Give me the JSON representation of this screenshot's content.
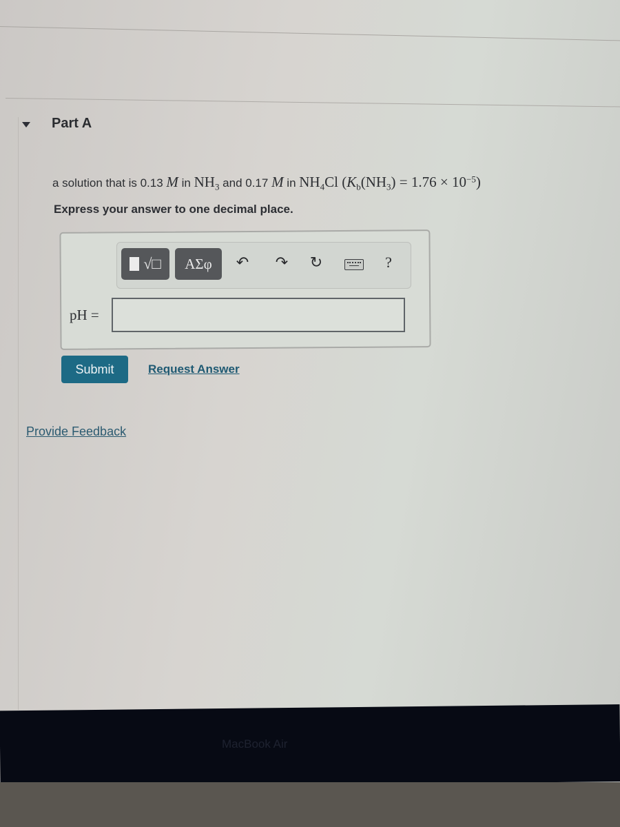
{
  "part": {
    "title": "Part A",
    "expanded": true
  },
  "question": {
    "prefix": "a solution that is ",
    "conc1": "0.13",
    "unit": "M",
    "in1": " in ",
    "species1": "NH",
    "species1_sub": "3",
    "and": " and ",
    "conc2": "0.17",
    "in2": " in ",
    "species2a": "NH",
    "species2_sub": "4",
    "species2b": "Cl",
    "kb_open": " (",
    "kb_symbol": "K",
    "kb_sub": "b",
    "kb_species_open": "(NH",
    "kb_species_sub": "3",
    "kb_species_close": ")",
    "kb_equals": " = 1.76 × 10",
    "kb_exp": "−5",
    "kb_close": ")"
  },
  "instruction": "Express your answer to one decimal place.",
  "toolbar": {
    "templates_icon": "templates-sqrt-icon",
    "greek_label": "ΑΣφ",
    "undo_icon": "↶",
    "redo_icon": "↷",
    "reset_icon": "↻",
    "keyboard_icon": "keyboard-icon",
    "help_label": "?"
  },
  "answer": {
    "label": "pH =",
    "value": "",
    "placeholder": ""
  },
  "actions": {
    "submit_label": "Submit",
    "request_label": "Request Answer"
  },
  "feedback_label": "Provide Feedback",
  "device": {
    "bezel_text": "MacBook Air"
  },
  "colors": {
    "submit_bg": "#1d6a85",
    "link": "#1f5a73",
    "toolbar_button": "#55575a"
  }
}
